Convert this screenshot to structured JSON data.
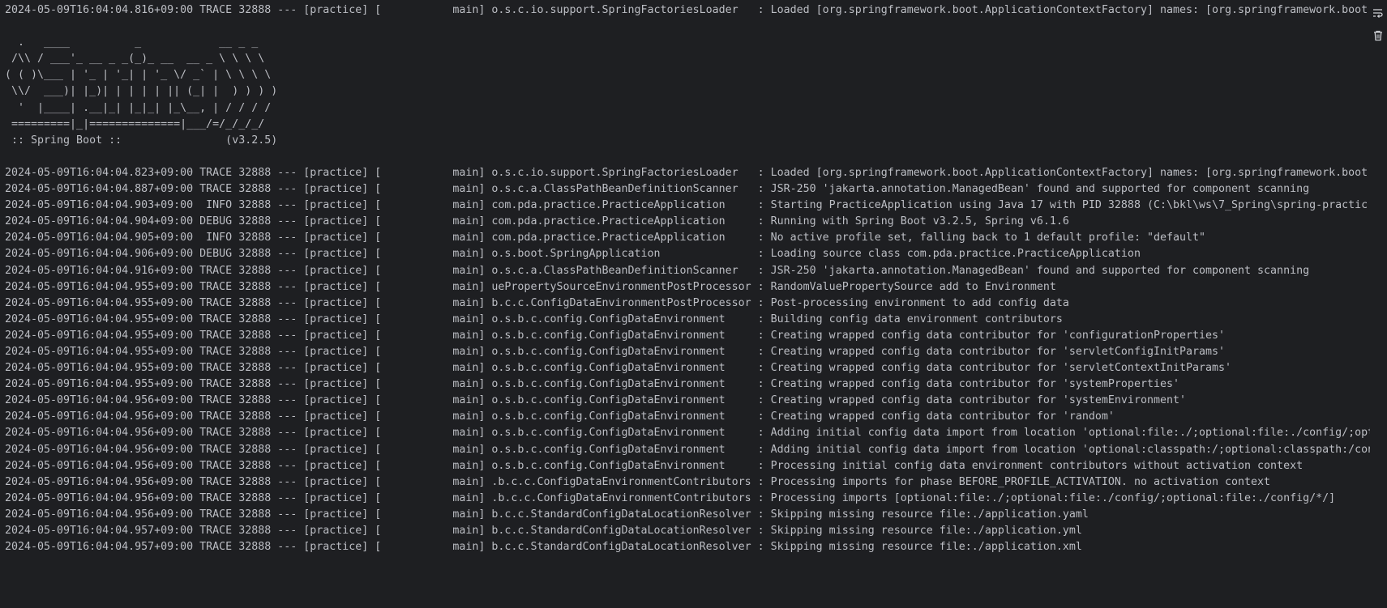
{
  "console": {
    "lines": [
      "2024-05-09T16:04:04.816+09:00 TRACE 32888 --- [practice] [           main] o.s.c.io.support.SpringFactoriesLoader   : Loaded [org.springframework.boot.ApplicationContextFactory] names: [org.springframework.boot",
      "",
      "  .   ____          _            __ _ _",
      " /\\\\ / ___'_ __ _ _(_)_ __  __ _ \\ \\ \\ \\",
      "( ( )\\___ | '_ | '_| | '_ \\/ _` | \\ \\ \\ \\",
      " \\\\/  ___)| |_)| | | | | || (_| |  ) ) ) )",
      "  '  |____| .__|_| |_|_| |_\\__, | / / / /",
      " =========|_|==============|___/=/_/_/_/",
      " :: Spring Boot ::                (v3.2.5)",
      "",
      "2024-05-09T16:04:04.823+09:00 TRACE 32888 --- [practice] [           main] o.s.c.io.support.SpringFactoriesLoader   : Loaded [org.springframework.boot.ApplicationContextFactory] names: [org.springframework.boot",
      "2024-05-09T16:04:04.887+09:00 TRACE 32888 --- [practice] [           main] o.s.c.a.ClassPathBeanDefinitionScanner   : JSR-250 'jakarta.annotation.ManagedBean' found and supported for component scanning",
      "2024-05-09T16:04:04.903+09:00  INFO 32888 --- [practice] [           main] com.pda.practice.PracticeApplication     : Starting PracticeApplication using Java 17 with PID 32888 (C:\\bkl\\ws\\7_Spring\\spring-practic",
      "2024-05-09T16:04:04.904+09:00 DEBUG 32888 --- [practice] [           main] com.pda.practice.PracticeApplication     : Running with Spring Boot v3.2.5, Spring v6.1.6",
      "2024-05-09T16:04:04.905+09:00  INFO 32888 --- [practice] [           main] com.pda.practice.PracticeApplication     : No active profile set, falling back to 1 default profile: \"default\"",
      "2024-05-09T16:04:04.906+09:00 DEBUG 32888 --- [practice] [           main] o.s.boot.SpringApplication               : Loading source class com.pda.practice.PracticeApplication",
      "2024-05-09T16:04:04.916+09:00 TRACE 32888 --- [practice] [           main] o.s.c.a.ClassPathBeanDefinitionScanner   : JSR-250 'jakarta.annotation.ManagedBean' found and supported for component scanning",
      "2024-05-09T16:04:04.955+09:00 TRACE 32888 --- [practice] [           main] uePropertySourceEnvironmentPostProcessor : RandomValuePropertySource add to Environment",
      "2024-05-09T16:04:04.955+09:00 TRACE 32888 --- [practice] [           main] b.c.c.ConfigDataEnvironmentPostProcessor : Post-processing environment to add config data",
      "2024-05-09T16:04:04.955+09:00 TRACE 32888 --- [practice] [           main] o.s.b.c.config.ConfigDataEnvironment     : Building config data environment contributors",
      "2024-05-09T16:04:04.955+09:00 TRACE 32888 --- [practice] [           main] o.s.b.c.config.ConfigDataEnvironment     : Creating wrapped config data contributor for 'configurationProperties'",
      "2024-05-09T16:04:04.955+09:00 TRACE 32888 --- [practice] [           main] o.s.b.c.config.ConfigDataEnvironment     : Creating wrapped config data contributor for 'servletConfigInitParams'",
      "2024-05-09T16:04:04.955+09:00 TRACE 32888 --- [practice] [           main] o.s.b.c.config.ConfigDataEnvironment     : Creating wrapped config data contributor for 'servletContextInitParams'",
      "2024-05-09T16:04:04.955+09:00 TRACE 32888 --- [practice] [           main] o.s.b.c.config.ConfigDataEnvironment     : Creating wrapped config data contributor for 'systemProperties'",
      "2024-05-09T16:04:04.956+09:00 TRACE 32888 --- [practice] [           main] o.s.b.c.config.ConfigDataEnvironment     : Creating wrapped config data contributor for 'systemEnvironment'",
      "2024-05-09T16:04:04.956+09:00 TRACE 32888 --- [practice] [           main] o.s.b.c.config.ConfigDataEnvironment     : Creating wrapped config data contributor for 'random'",
      "2024-05-09T16:04:04.956+09:00 TRACE 32888 --- [practice] [           main] o.s.b.c.config.ConfigDataEnvironment     : Adding initial config data import from location 'optional:file:./;optional:file:./config/;opt",
      "2024-05-09T16:04:04.956+09:00 TRACE 32888 --- [practice] [           main] o.s.b.c.config.ConfigDataEnvironment     : Adding initial config data import from location 'optional:classpath:/;optional:classpath:/con",
      "2024-05-09T16:04:04.956+09:00 TRACE 32888 --- [practice] [           main] o.s.b.c.config.ConfigDataEnvironment     : Processing initial config data environment contributors without activation context",
      "2024-05-09T16:04:04.956+09:00 TRACE 32888 --- [practice] [           main] .b.c.c.ConfigDataEnvironmentContributors : Processing imports for phase BEFORE_PROFILE_ACTIVATION. no activation context",
      "2024-05-09T16:04:04.956+09:00 TRACE 32888 --- [practice] [           main] .b.c.c.ConfigDataEnvironmentContributors : Processing imports [optional:file:./;optional:file:./config/;optional:file:./config/*/]",
      "2024-05-09T16:04:04.956+09:00 TRACE 32888 --- [practice] [           main] b.c.c.StandardConfigDataLocationResolver : Skipping missing resource file:./application.yaml",
      "2024-05-09T16:04:04.957+09:00 TRACE 32888 --- [practice] [           main] b.c.c.StandardConfigDataLocationResolver : Skipping missing resource file:./application.yml",
      "2024-05-09T16:04:04.957+09:00 TRACE 32888 --- [practice] [           main] b.c.c.StandardConfigDataLocationResolver : Skipping missing resource file:./application.xml"
    ]
  },
  "gutter": {
    "icons": [
      "soft-wrap-icon",
      "trash-icon"
    ]
  },
  "colors": {
    "background": "#1e1f22",
    "text": "#bcbec4",
    "icon": "#cfd1d6"
  }
}
